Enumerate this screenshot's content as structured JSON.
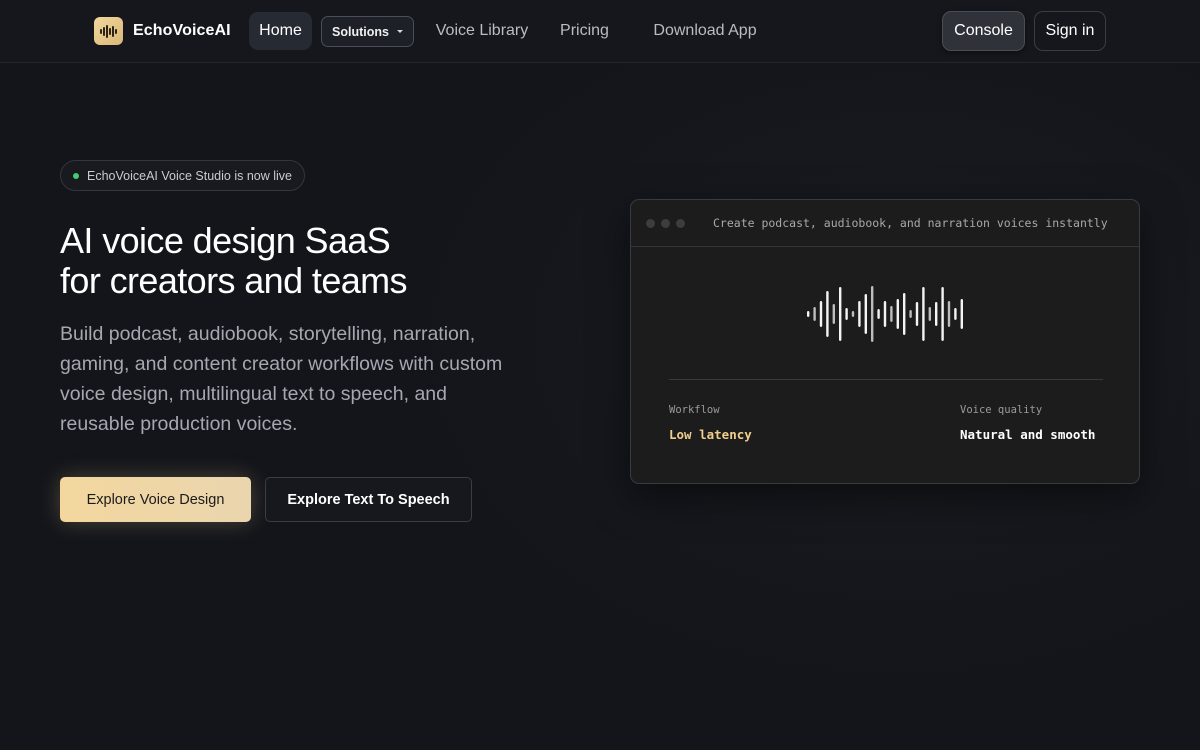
{
  "brand": {
    "name": "EchoVoiceAI",
    "icon": "waveform-icon",
    "accent": "#f3d79e"
  },
  "nav": {
    "home": "Home",
    "solutions": "Solutions",
    "voice_library": "Voice Library",
    "pricing": "Pricing",
    "download_app": "Download App",
    "console": "Console",
    "sign_in": "Sign in"
  },
  "hero": {
    "badge": "EchoVoiceAI Voice Studio is now live",
    "title_line1": "AI voice design SaaS",
    "title_line2": "for creators and teams",
    "description": "Build podcast, audiobook, storytelling, narration, gaming, and content creator workflows with custom voice design, multilingual text to speech, and reusable production voices.",
    "primary_cta": "Explore Voice Design",
    "secondary_cta": "Explore Text To Speech"
  },
  "preview": {
    "caption": "Create podcast, audiobook, and narration voices instantly",
    "stats": [
      {
        "label": "Workflow",
        "value": "Low latency",
        "color": "#f0cf8e"
      },
      {
        "label": "Voice quality",
        "value": "Natural and smooth",
        "color": "#ffffff"
      }
    ]
  },
  "colors": {
    "background": "#13151b",
    "status_live": "#3ecf6e"
  }
}
